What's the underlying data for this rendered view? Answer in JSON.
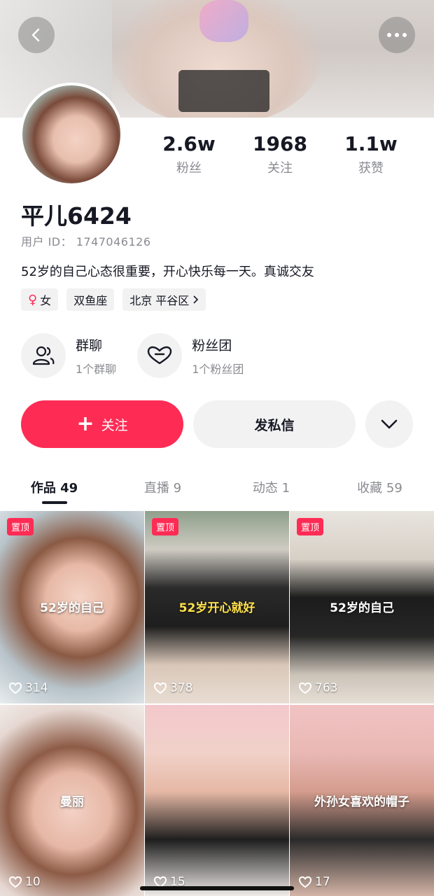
{
  "profile": {
    "name": "平儿6424",
    "user_id": "用户 ID： 1747046126",
    "bio": "52岁的自己心态很重要，开心快乐每一天。真诚交友"
  },
  "stats": [
    {
      "value": "2.6w",
      "label": "粉丝"
    },
    {
      "value": "1968",
      "label": "关注"
    },
    {
      "value": "1.1w",
      "label": "获赞"
    }
  ],
  "tags": {
    "gender": "女",
    "zodiac": "双鱼座",
    "location": "北京 平谷区"
  },
  "groups": [
    {
      "title": "群聊",
      "sub": "1个群聊",
      "icon": "group-chat-icon"
    },
    {
      "title": "粉丝团",
      "sub": "1个粉丝团",
      "icon": "fan-club-heart-icon"
    }
  ],
  "actions": {
    "follow": "关注",
    "message": "发私信"
  },
  "tabs": [
    {
      "label": "作品",
      "count": "49"
    },
    {
      "label": "直播",
      "count": "9"
    },
    {
      "label": "动态",
      "count": "1"
    },
    {
      "label": "收藏",
      "count": "59"
    }
  ],
  "pin_label": "置顶",
  "videos": [
    {
      "caption": "52岁的自己",
      "likes": "314",
      "pinned": true
    },
    {
      "caption": "52岁开心就好",
      "likes": "378",
      "pinned": true
    },
    {
      "caption": "52岁的自己",
      "likes": "763",
      "pinned": true
    },
    {
      "caption": "曼丽",
      "likes": "10",
      "pinned": false
    },
    {
      "caption": "",
      "likes": "15",
      "pinned": false
    },
    {
      "caption": "外孙女喜欢的帽子",
      "likes": "17",
      "pinned": false
    }
  ],
  "colors": {
    "accent": "#fe2c55",
    "secondary_bg": "#f2f2f3",
    "muted_text": "#8a8b91"
  }
}
